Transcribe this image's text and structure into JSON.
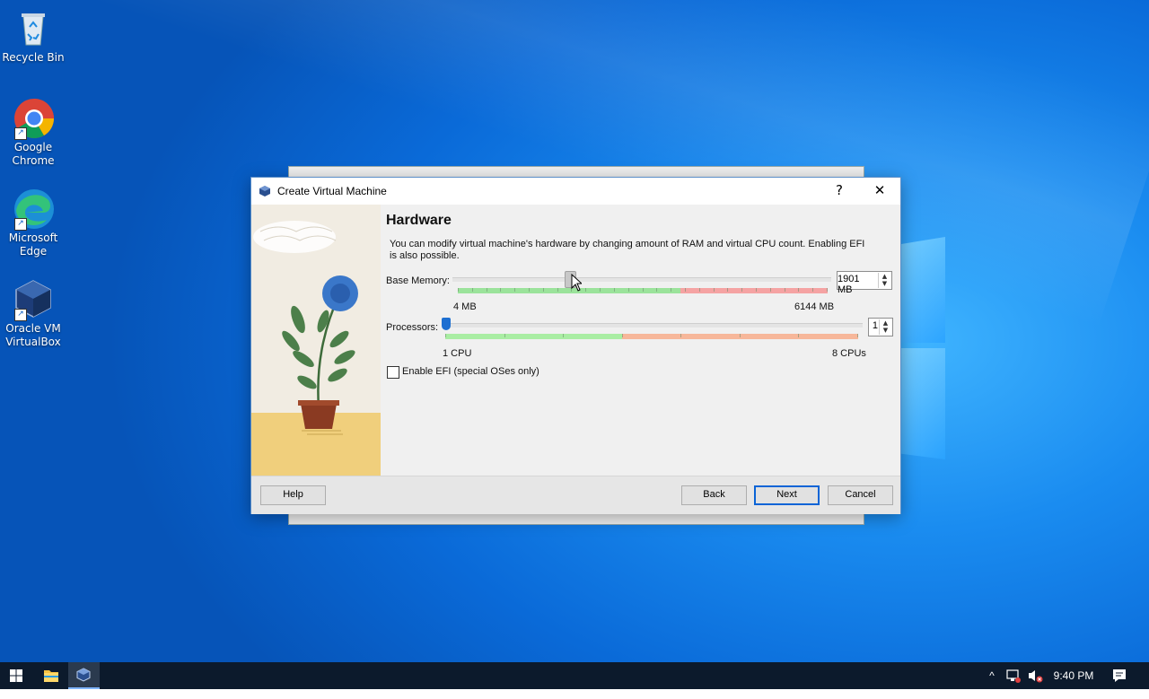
{
  "desktop": {
    "icons": [
      {
        "label": "Recycle Bin"
      },
      {
        "label": "Google Chrome"
      },
      {
        "label": "Microsoft Edge"
      },
      {
        "label": "Oracle VM VirtualBox"
      }
    ]
  },
  "dialog": {
    "title": "Create Virtual Machine",
    "help_glyph": "?",
    "close_glyph": "✕",
    "page_title": "Hardware",
    "description": "You can modify virtual machine's hardware by changing amount of RAM and virtual CPU count. Enabling EFI is also possible.",
    "memory": {
      "label": "Base Memory:",
      "value": "1901 MB",
      "min_label": "4 MB",
      "max_label": "6144 MB",
      "min": 4,
      "max": 6144,
      "current": 1901
    },
    "processors": {
      "label": "Processors:",
      "value": "1",
      "min_label": "1 CPU",
      "max_label": "8 CPUs",
      "min": 1,
      "max": 8,
      "current": 1
    },
    "efi": {
      "label": "Enable EFI (special OSes only)",
      "checked": false
    },
    "buttons": {
      "help": "Help",
      "back": "Back",
      "next": "Next",
      "cancel": "Cancel"
    }
  },
  "taskbar": {
    "time": "9:40 PM"
  },
  "colors": {
    "accent": "#0a64d6",
    "desktop_blue": "#1a8cf0",
    "scale_green": "#9be39b",
    "scale_red": "#f5a3a3",
    "scale_orange": "#f7b79a"
  }
}
